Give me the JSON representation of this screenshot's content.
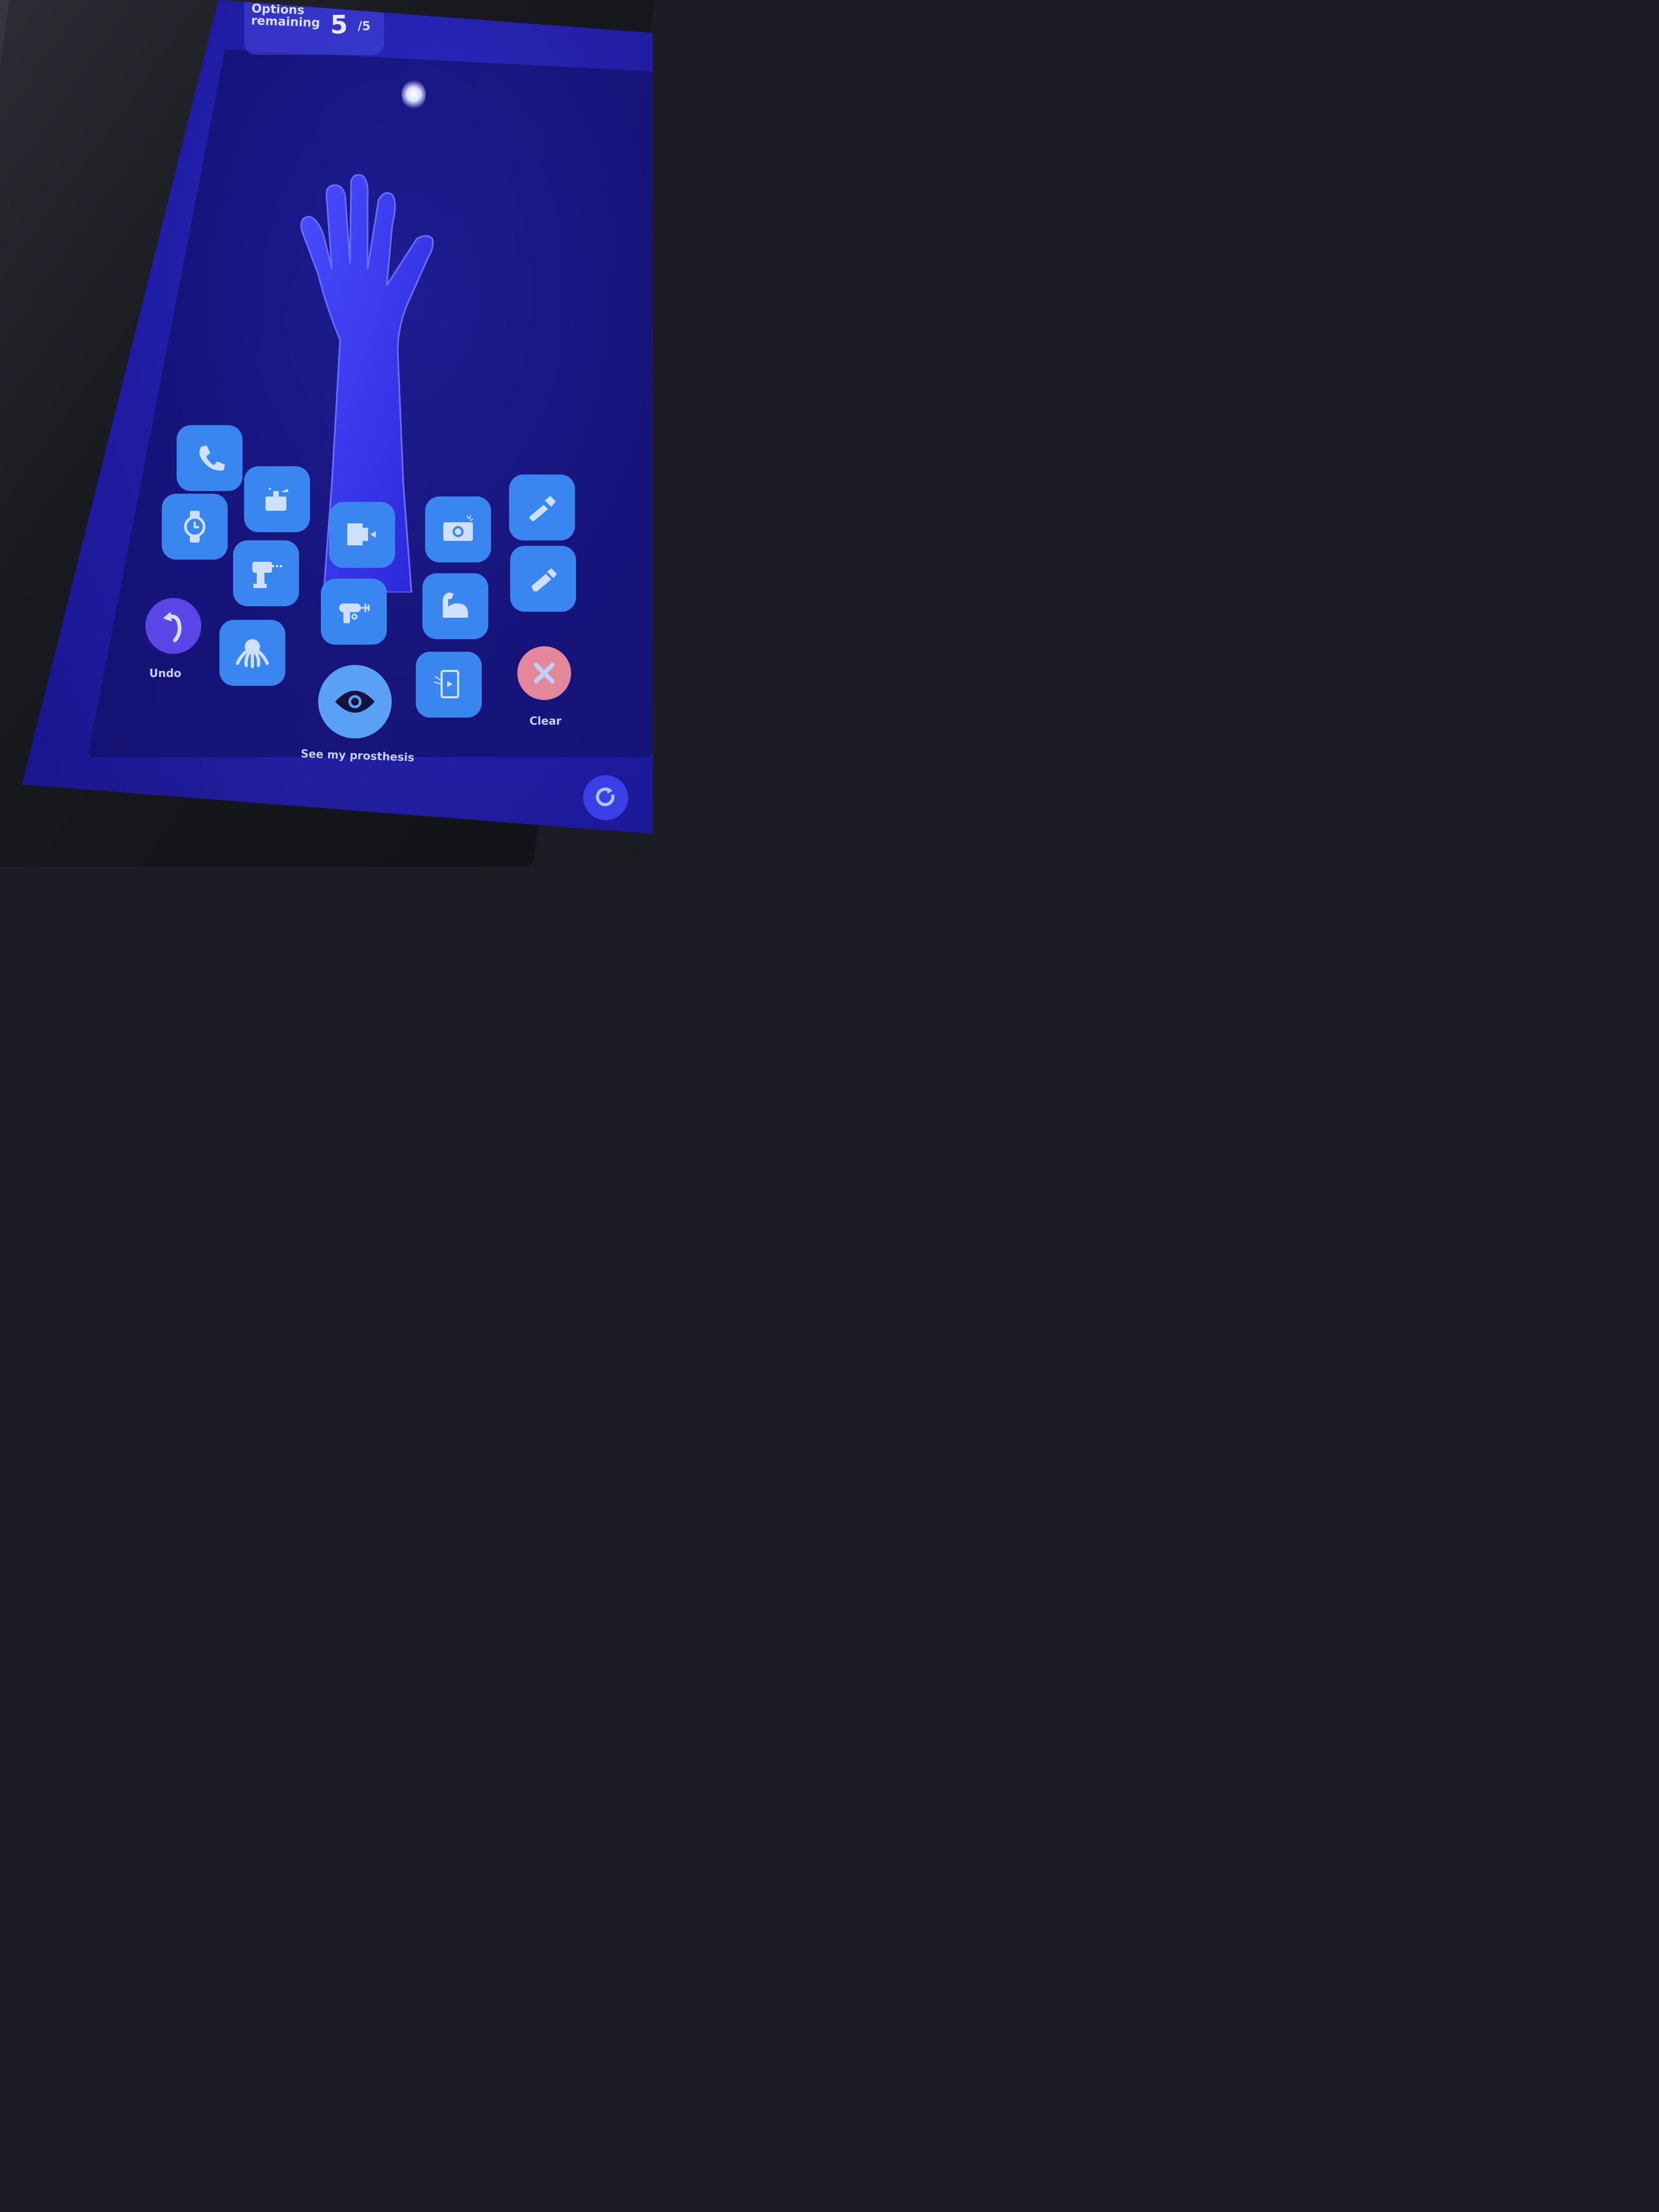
{
  "counter": {
    "label": "Options remaining",
    "remaining": "5",
    "max": "/5"
  },
  "tiles": [
    {
      "icon": "phone-icon"
    },
    {
      "icon": "perfume-bottle-icon"
    },
    {
      "icon": "watch-icon"
    },
    {
      "icon": "card-reader-icon"
    },
    {
      "icon": "camera-icon"
    },
    {
      "icon": "flashlight-icon"
    },
    {
      "icon": "drill-icon"
    },
    {
      "icon": "ray-gun-icon"
    },
    {
      "icon": "flexed-arm-icon"
    },
    {
      "icon": "usb-stick-icon"
    },
    {
      "icon": "octopus-icon"
    },
    {
      "icon": "tablet-video-icon"
    }
  ],
  "actions": {
    "undo_label": "Undo",
    "see_label": "See my prosthesis",
    "clear_label": "Clear"
  },
  "colors": {
    "tile": "#3a86f0",
    "undo": "#5a45e6",
    "clear": "#e3879a",
    "see": "#5aa0f5",
    "screen": "#1d1aa5"
  }
}
